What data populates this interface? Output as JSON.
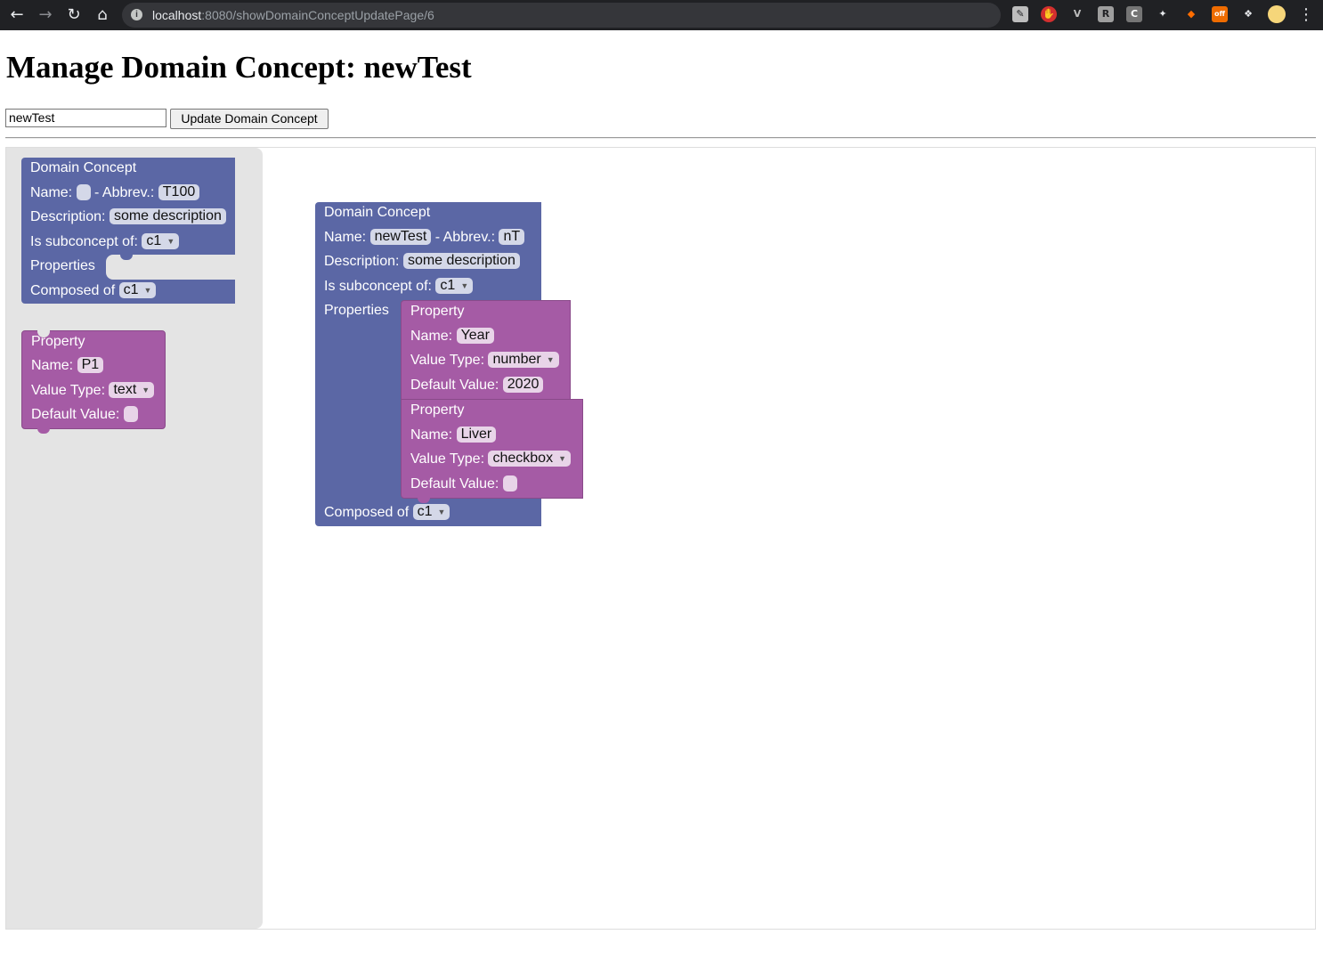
{
  "browser": {
    "url_host": "localhost",
    "url_rest": ":8080/showDomainConceptUpdatePage/6",
    "icons": [
      "back-icon",
      "forward-icon",
      "reload-icon",
      "home-icon",
      "site-info-icon",
      "extension-icons",
      "menu-icon"
    ]
  },
  "page": {
    "title": "Manage Domain Concept: newTest",
    "name_input_value": "newTest",
    "update_button_label": "Update Domain Concept"
  },
  "toolbox": {
    "domain_concept": {
      "header": "Domain Concept",
      "name_label": "Name:",
      "name_value": "",
      "abbrev_label": "Abbrev.:",
      "abbrev_value": "T100",
      "sep": "-",
      "description_label": "Description:",
      "description_value": "some description",
      "subconcept_label": "Is subconcept of:",
      "subconcept_value": "c1",
      "properties_label": "Properties",
      "composed_label": "Composed of",
      "composed_value": "c1"
    },
    "property": {
      "header": "Property",
      "name_label": "Name:",
      "name_value": "P1",
      "value_type_label": "Value Type:",
      "value_type_value": "text",
      "default_label": "Default Value:",
      "default_value": ""
    }
  },
  "canvas": {
    "domain_concept": {
      "header": "Domain Concept",
      "name_label": "Name:",
      "name_value": "newTest",
      "sep": "-",
      "abbrev_label": "Abbrev.:",
      "abbrev_value": "nT",
      "description_label": "Description:",
      "description_value": "some description",
      "subconcept_label": "Is subconcept of:",
      "subconcept_value": "c1",
      "properties_label": "Properties",
      "composed_label": "Composed of",
      "composed_value": "c1"
    },
    "properties": [
      {
        "header": "Property",
        "name_label": "Name:",
        "name_value": "Year",
        "value_type_label": "Value Type:",
        "value_type_value": "number",
        "default_label": "Default Value:",
        "default_value": "2020"
      },
      {
        "header": "Property",
        "name_label": "Name:",
        "name_value": "Liver",
        "value_type_label": "Value Type:",
        "value_type_value": "checkbox",
        "default_label": "Default Value:",
        "default_value": ""
      }
    ]
  },
  "colors": {
    "domain_concept_block": "#5b67a5",
    "property_block": "#a55ba5",
    "toolbox_bg": "#e4e4e4"
  }
}
